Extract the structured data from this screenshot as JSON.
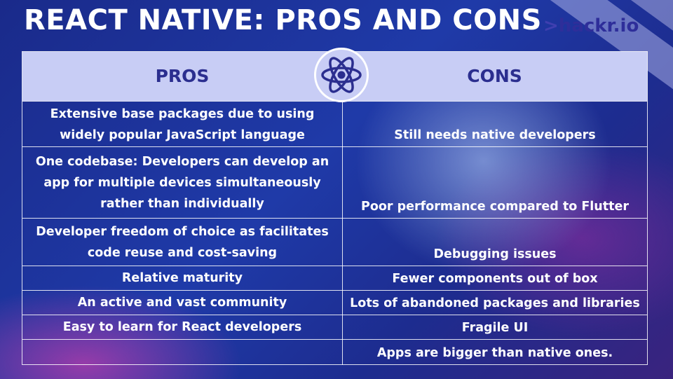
{
  "title": "REACT NATIVE: PROS AND CONS",
  "brand": {
    "prefix": ">",
    "name": "hackr.io"
  },
  "table": {
    "headers": {
      "pros": "PROS",
      "cons": "CONS"
    },
    "rows": [
      {
        "pros": "Extensive base packages due to using widely popular JavaScript language",
        "cons": "Still needs native developers"
      },
      {
        "pros": "One codebase: Developers can develop an app for multiple devices simultaneously rather than individually",
        "cons": "Poor performance compared to Flutter"
      },
      {
        "pros": "Developer freedom of choice as facilitates code reuse and cost-saving",
        "cons": "Debugging issues"
      },
      {
        "pros": "Relative maturity",
        "cons": "Fewer components out of box"
      },
      {
        "pros": "An active and vast community",
        "cons": "Lots of abandoned packages and libraries"
      },
      {
        "pros": "Easy to learn for React developers",
        "cons": "Fragile UI"
      },
      {
        "pros": "",
        "cons": "Apps are bigger than native ones."
      }
    ]
  },
  "icons": {
    "center": "react-atom-icon"
  },
  "colors": {
    "header_bg": "#c8cdf5",
    "header_text": "#2b2e8f",
    "background": "#1f3aa8",
    "text": "#ffffff"
  }
}
